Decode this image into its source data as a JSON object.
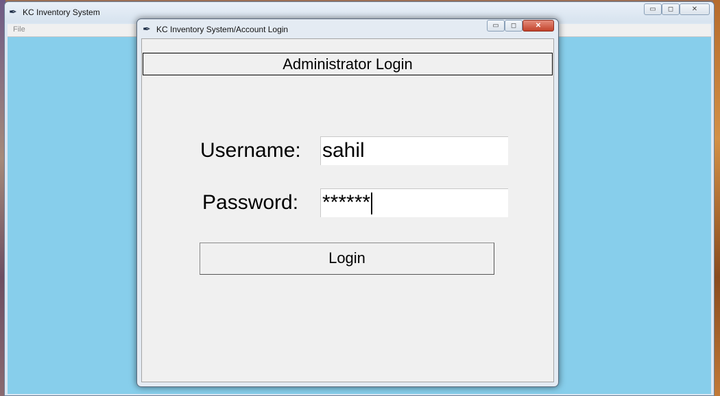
{
  "main_window": {
    "title": "KC Inventory System",
    "menu": {
      "file": "File"
    },
    "controls": {
      "minimize": "▭",
      "maximize": "◻",
      "close": "✕"
    }
  },
  "dialog": {
    "title": "KC Inventory System/Account Login",
    "controls": {
      "minimize": "▭",
      "maximize": "◻",
      "close": "✕"
    },
    "header": "Administrator Login",
    "username_label": "Username:",
    "username_value": "sahil",
    "password_label": "Password:",
    "password_value": "******",
    "login_button": "Login"
  },
  "icons": {
    "app_icon": "feather-icon"
  },
  "colors": {
    "client_background": "#87ceeb",
    "dialog_background": "#f0f0f0",
    "close_button": "#c2432b"
  }
}
